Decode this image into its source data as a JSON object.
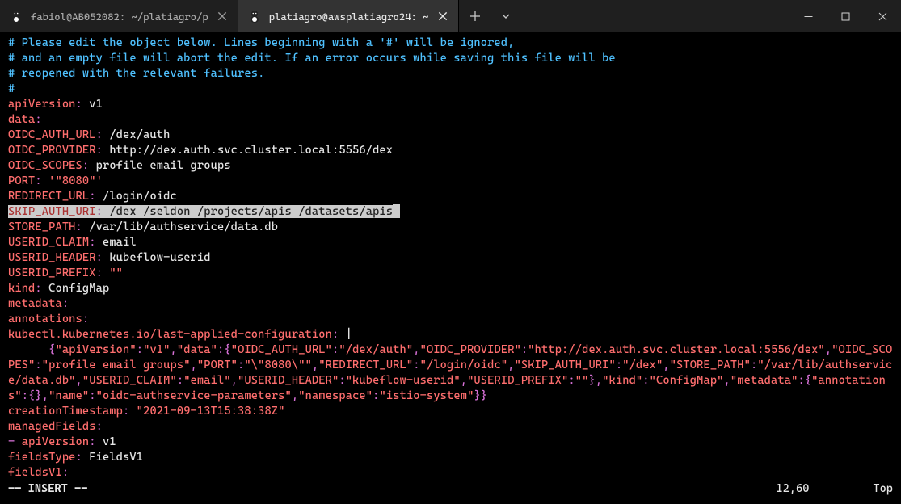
{
  "tabs": [
    {
      "title": "fabiol@AB052082: ~/platiagro/p",
      "active": false
    },
    {
      "title": "platiagro@awsplatiagro24: ~",
      "active": true
    }
  ],
  "editor": {
    "comment1": "# Please edit the object below. Lines beginning with a '#' will be ignored,",
    "comment2": "# and an empty file will abort the edit. If an error occurs while saving this file will be",
    "comment3": "# reopened with the relevant failures.",
    "comment4": "#",
    "apiVersion_k": "apiVersion",
    "apiVersion_v": "v1",
    "data_k": "data",
    "oidc_auth_url_k": "OIDC_AUTH_URL",
    "oidc_auth_url_v": "/dex/auth",
    "oidc_provider_k": "OIDC_PROVIDER",
    "oidc_provider_v": "http://dex.auth.svc.cluster.local:5556/dex",
    "oidc_scopes_k": "OIDC_SCOPES",
    "oidc_scopes_v": "profile email groups",
    "port_k": "PORT",
    "port_v": "'\"8080\"'",
    "redirect_url_k": "REDIRECT_URL",
    "redirect_url_v": "/login/oidc",
    "skip_auth_uri_k": "SKIP_AUTH_URI",
    "skip_auth_uri_v": "/dex /seldon /projects/apis /datasets/apis",
    "store_path_k": "STORE_PATH",
    "store_path_v": "/var/lib/authservice/data.db",
    "userid_claim_k": "USERID_CLAIM",
    "userid_claim_v": "email",
    "userid_header_k": "USERID_HEADER",
    "userid_header_v": "kubeflow-userid",
    "userid_prefix_k": "USERID_PREFIX",
    "userid_prefix_v": "\"\"",
    "kind_k": "kind",
    "kind_v": "ConfigMap",
    "metadata_k": "metadata",
    "annotations_k": "annotations",
    "lastapplied_k": "kubectl.kubernetes.io/last-applied-configuration",
    "json": {
      "lbrace": "{",
      "rbrace": "}",
      "lbrace2": "{",
      "rbrace2": "}",
      "lbrace3": "{",
      "rbrace3": "}",
      "rbrace_dbl": "}}",
      "apiVersion_k": "\"apiVersion\"",
      "apiVersion_v": "\"v1\"",
      "data_k": "\"data\"",
      "oidc_auth_url_k": "\"OIDC_AUTH_URL\"",
      "oidc_auth_url_v": "\"/dex/auth\"",
      "oidc_provider_k": "\"OIDC_PROVIDER\"",
      "oidc_provider_v": "\"http://dex.auth.svc.cluster.local:5556/dex\"",
      "oidc_scopes_k": "\"OIDC_SCOPES\"",
      "oidc_scopes_v": "\"profile email groups\"",
      "port_k": "\"PORT\"",
      "port_v": "\"\\\"8080\\\"\"",
      "redirect_url_k": "\"REDIRECT_URL\"",
      "redirect_url_v": "\"/login/oidc\"",
      "skip_auth_uri_k": "\"SKIP_AUTH_URI\"",
      "skip_auth_uri_v": "\"/dex\"",
      "store_path_k": "\"STORE_PATH\"",
      "store_path_v": "\"/var/lib/authservice/data.db\"",
      "userid_claim_k": "\"USERID_CLAIM\"",
      "userid_claim_v": "\"email\"",
      "userid_header_k": "\"USERID_HEADER\"",
      "userid_header_v": "\"kubeflow-userid\"",
      "userid_prefix_k": "\"USERID_PREFIX\"",
      "userid_prefix_v": "\"\"",
      "kind_k": "\"kind\"",
      "kind_v": "\"ConfigMap\"",
      "metadata_k": "\"metadata\"",
      "annotations_k": "\"annotations\"",
      "name_k": "\"name\"",
      "name_v": "\"oidc-authservice-parameters\"",
      "namespace_k": "\"namespace\"",
      "namespace_v": "\"istio-system\""
    },
    "creationTs_k": "creationTimestamp",
    "creationTs_v": "\"2021-09-13T15:38:38Z\"",
    "managedFields_k": "managedFields",
    "li_apiVersion_k": "apiVersion",
    "li_apiVersion_v": "v1",
    "fieldsType_k": "fieldsType",
    "fieldsType_v": "FieldsV1",
    "fieldsV1_k": "fieldsV1"
  },
  "status": {
    "mode": "-- INSERT --",
    "pos": "12,60",
    "scroll": "Top"
  }
}
